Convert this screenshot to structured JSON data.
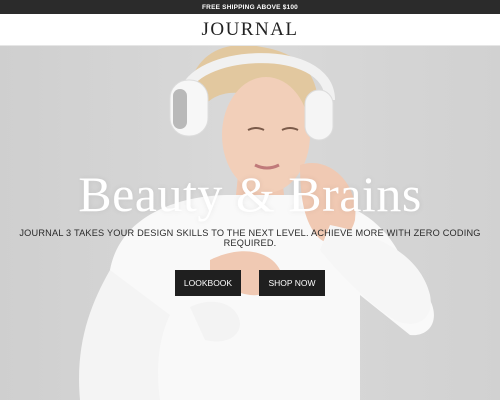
{
  "topbar": {
    "text": "FREE SHIPPING ABOVE $100"
  },
  "header": {
    "logo": "JOURNAL"
  },
  "hero": {
    "title": "Beauty & Brains",
    "subtitle": "JOURNAL 3 TAKES YOUR DESIGN SKILLS TO THE NEXT LEVEL. ACHIEVE MORE WITH ZERO CODING REQUIRED.",
    "buttons": [
      {
        "label": "LOOKBOOK"
      },
      {
        "label": "SHOP NOW"
      }
    ]
  },
  "colors": {
    "topbar_bg": "#2b2b2b",
    "button_bg": "#1f1f1f",
    "hero_bg": "#d3d3d3"
  }
}
